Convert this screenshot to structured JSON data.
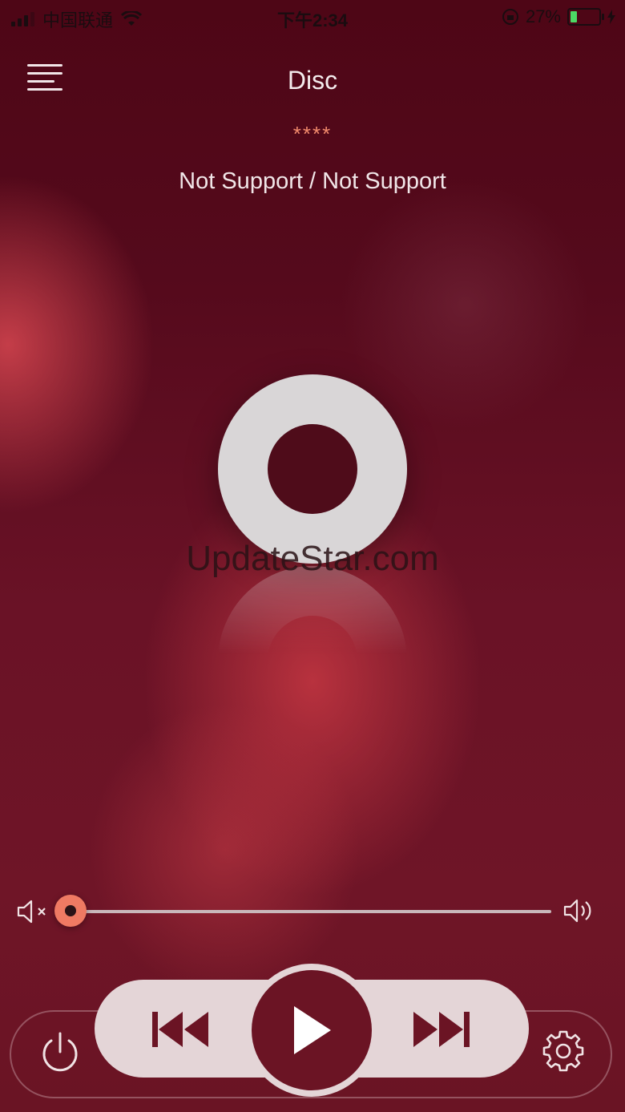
{
  "status_bar": {
    "carrier": "中国联通",
    "time": "下午2:34",
    "battery_percent": "27%",
    "battery_level": 0.27
  },
  "header": {
    "title": "Disc",
    "rating": "****",
    "track_info": "Not Support / Not Support"
  },
  "watermark": "UpdateStar.com",
  "volume": {
    "level": 0.0,
    "mute_icon": "speaker-mute-icon",
    "max_icon": "speaker-loud-icon"
  },
  "controls": {
    "menu_icon": "menu-lines-icon",
    "prev_icon": "skip-back-icon",
    "play_icon": "play-icon",
    "next_icon": "skip-forward-icon",
    "power_icon": "power-icon",
    "settings_icon": "gear-icon"
  },
  "colors": {
    "accent": "#ef7a63",
    "play_button": "#6b1424",
    "pill": "#e4d5d7"
  }
}
